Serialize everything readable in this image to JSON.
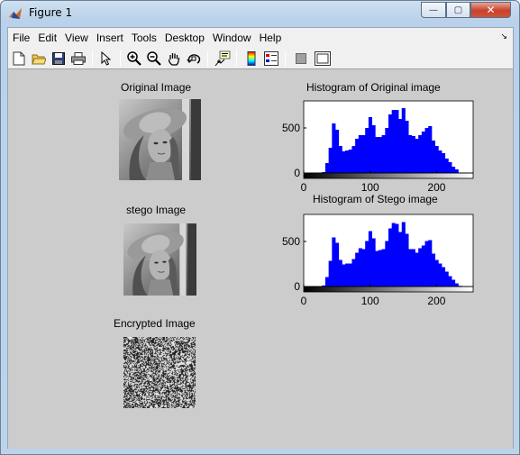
{
  "window": {
    "title": "Figure 1",
    "minimize_glyph": "—",
    "maximize_glyph": "▢",
    "close_glyph": "✕"
  },
  "menu": {
    "items": [
      "File",
      "Edit",
      "View",
      "Insert",
      "Tools",
      "Desktop",
      "Window",
      "Help"
    ],
    "overflow_glyph": "↘"
  },
  "toolbar": {
    "buttons": [
      "new-figure-icon",
      "open-file-icon",
      "save-icon",
      "print-icon",
      "pointer-arrow-icon",
      "zoom-in-icon",
      "zoom-out-icon",
      "pan-hand-icon",
      "rotate-3d-icon",
      "data-cursor-icon",
      "colorbar-icon",
      "legend-icon",
      "hide-plot-tools-icon",
      "show-plot-tools-icon"
    ]
  },
  "figure": {
    "original_title": "Original Image",
    "stego_title": "stego Image",
    "encrypted_title": "Encrypted Image",
    "hist1_title": "Histogram of Original  image",
    "hist2_title": "Histogram of Stego image"
  },
  "chart_data": [
    {
      "type": "bar",
      "title": "Histogram of Original  image",
      "xlabel": "",
      "ylabel": "",
      "xlim": [
        0,
        255
      ],
      "ylim": [
        0,
        800
      ],
      "xticks": [
        0,
        100,
        200
      ],
      "yticks": [
        0,
        500
      ],
      "grid": false,
      "colorbar": "grayscale gradient below x axis",
      "bar_color": "#0000ff",
      "x": [
        25,
        30,
        35,
        40,
        45,
        50,
        55,
        60,
        65,
        70,
        75,
        80,
        85,
        90,
        95,
        100,
        105,
        110,
        115,
        120,
        125,
        130,
        135,
        140,
        145,
        150,
        155,
        160,
        165,
        170,
        175,
        180,
        185,
        190,
        195,
        200,
        205,
        210,
        215,
        220,
        225,
        230,
        235,
        240
      ],
      "values": [
        0,
        10,
        110,
        280,
        550,
        480,
        300,
        240,
        250,
        260,
        300,
        380,
        420,
        420,
        500,
        620,
        530,
        400,
        400,
        420,
        500,
        650,
        700,
        700,
        600,
        720,
        580,
        420,
        410,
        380,
        420,
        460,
        500,
        520,
        360,
        300,
        250,
        220,
        160,
        120,
        70,
        40,
        5,
        0
      ]
    },
    {
      "type": "bar",
      "title": "Histogram of Stego image",
      "xlabel": "",
      "ylabel": "",
      "xlim": [
        0,
        255
      ],
      "ylim": [
        0,
        800
      ],
      "xticks": [
        0,
        100,
        200
      ],
      "yticks": [
        0,
        500
      ],
      "grid": false,
      "colorbar": "grayscale gradient below x axis",
      "bar_color": "#0000ff",
      "x": [
        25,
        30,
        35,
        40,
        45,
        50,
        55,
        60,
        65,
        70,
        75,
        80,
        85,
        90,
        95,
        100,
        105,
        110,
        115,
        120,
        125,
        130,
        135,
        140,
        145,
        150,
        155,
        160,
        165,
        170,
        175,
        180,
        185,
        190,
        195,
        200,
        205,
        210,
        215,
        220,
        225,
        230,
        235,
        240
      ],
      "values": [
        0,
        12,
        105,
        285,
        545,
        485,
        295,
        245,
        255,
        255,
        305,
        375,
        425,
        415,
        505,
        615,
        535,
        395,
        405,
        415,
        505,
        645,
        705,
        695,
        605,
        715,
        585,
        415,
        415,
        375,
        425,
        455,
        505,
        515,
        365,
        295,
        255,
        215,
        165,
        115,
        75,
        35,
        8,
        0
      ]
    }
  ]
}
